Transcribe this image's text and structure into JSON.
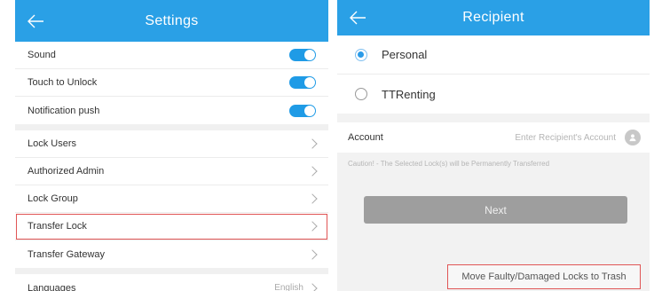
{
  "colors": {
    "header": "#2aa0e6",
    "toggle_on": "#1f9be6",
    "button_disabled": "#9e9e9e",
    "highlight": "#e05555"
  },
  "settings": {
    "title": "Settings",
    "back_icon": "arrow-left-icon",
    "toggles": [
      {
        "label": "Sound",
        "on": true
      },
      {
        "label": "Touch to Unlock",
        "on": true
      },
      {
        "label": "Notification push",
        "on": true
      }
    ],
    "items": [
      {
        "label": "Lock Users"
      },
      {
        "label": "Authorized Admin"
      },
      {
        "label": "Lock Group"
      },
      {
        "label": "Transfer Lock"
      },
      {
        "label": "Transfer Gateway"
      }
    ],
    "languages": {
      "label": "Languages",
      "value": "English"
    }
  },
  "recipient": {
    "title": "Recipient",
    "back_icon": "arrow-left-icon",
    "options": [
      {
        "label": "Personal",
        "selected": true
      },
      {
        "label": "TTRenting",
        "selected": false
      }
    ],
    "account": {
      "label": "Account",
      "placeholder": "Enter Recipient's Account",
      "value": ""
    },
    "caution": "Caution! - The Selected Lock(s) will be Permanently Transferred",
    "next_label": "Next",
    "trash_link": "Move Faulty/Damaged Locks to Trash"
  }
}
